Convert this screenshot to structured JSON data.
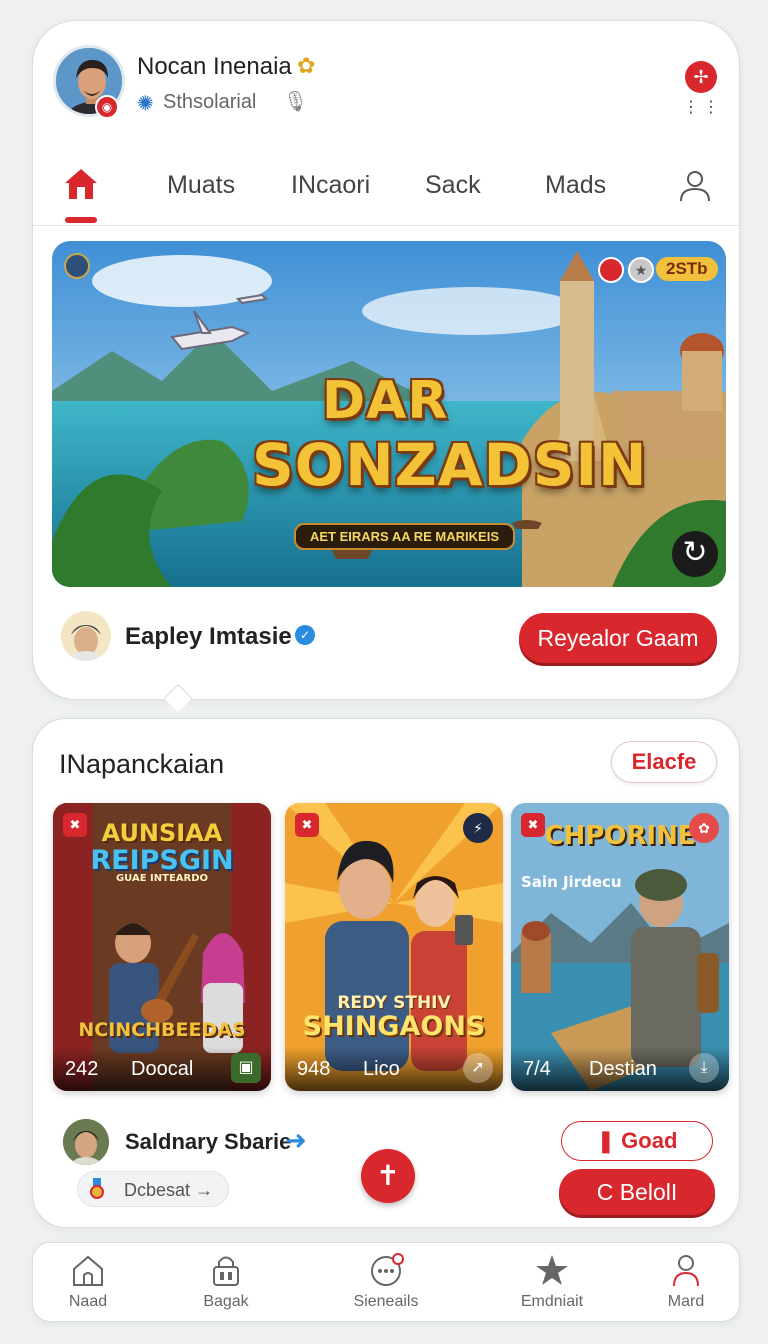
{
  "profile": {
    "name": "Nocan Inenaia",
    "subtitle": "Sthsolarial",
    "avatar_icon": "profile-avatar",
    "flower_icon": "flower-icon",
    "mic_icon": "mic-icon"
  },
  "tabs": [
    {
      "label": "",
      "icon": "home-icon",
      "active": true
    },
    {
      "label": "Muats"
    },
    {
      "label": "INcaori"
    },
    {
      "label": "Sack"
    },
    {
      "label": "Mads"
    },
    {
      "label": "",
      "icon": "user-icon"
    }
  ],
  "hero": {
    "title_line1": "DAR",
    "title_line2": "SONZADSIN",
    "tagline": "AET EIRARS AA RE MARIKEIS",
    "count_badge": "2STb",
    "creator_name": "Eapley Imtasie",
    "primary_button": "Reyealor Gaam"
  },
  "section": {
    "title": "INapanckaian",
    "action_button": "Elacfe"
  },
  "games": [
    {
      "art_title_1": "AUNSIAA",
      "art_title_2": "REIPSGIN",
      "art_subtitle": "GUAE INTEARDO",
      "art_footer_title": "NCINCHBEEDAS",
      "count": "242",
      "label": "Doocal"
    },
    {
      "art_title_1": "REDY STHIV",
      "art_title_2": "SHINGAONS",
      "count": "948",
      "label": "Lico"
    },
    {
      "art_title_1": "CHPORINE",
      "art_subtitle": "Sain Jirdecu",
      "count": "7/4",
      "label": "Destian"
    }
  ],
  "streamer": {
    "name": "Saldnary Sbarie",
    "chip_label": "Dcbesat",
    "chip_arrow": "→",
    "outline_button": "Goad",
    "primary_button": "C BelolI"
  },
  "bottom_nav": [
    {
      "label": "Naad",
      "icon": "home-outline-icon"
    },
    {
      "label": "Bagak",
      "icon": "lock-bag-icon"
    },
    {
      "label": "Sieneails",
      "icon": "chat-bubble-icon"
    },
    {
      "label": "Emdniait",
      "icon": "star-icon"
    },
    {
      "label": "Mard",
      "icon": "person-icon"
    }
  ],
  "colors": {
    "accent": "#d9272e",
    "verified": "#2a8be0",
    "background": "#eef1f0"
  }
}
